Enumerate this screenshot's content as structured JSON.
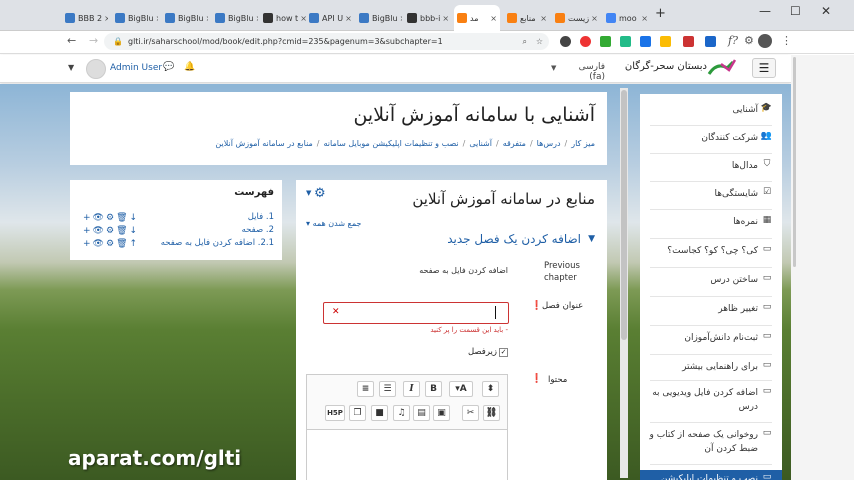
{
  "browser": {
    "tabs": [
      {
        "label": "BBB 2",
        "fav": "#3b79c4"
      },
      {
        "label": "BigBlu",
        "fav": "#3b79c4"
      },
      {
        "label": "BigBlu",
        "fav": "#3b79c4"
      },
      {
        "label": "BigBlu",
        "fav": "#3b79c4"
      },
      {
        "label": "how t",
        "fav": "#333333"
      },
      {
        "label": "API U",
        "fav": "#3b79c4"
      },
      {
        "label": "BigBlu",
        "fav": "#3b79c4"
      },
      {
        "label": "bbb-i",
        "fav": "#333333"
      },
      {
        "label": "مد",
        "fav": "#f98012",
        "active": true
      },
      {
        "label": "منابع",
        "fav": "#f98012"
      },
      {
        "label": "زیست",
        "fav": "#f98012"
      },
      {
        "label": "moo",
        "fav": "#4285f4"
      }
    ],
    "new_tab": "+",
    "url": "glti.ir/saharschool/mod/book/edit.php?cmid=235&pagenum=3&subchapter=1"
  },
  "navbar": {
    "site_name": "دبستان سحر-گرگان",
    "language": "فارسی (fa)",
    "user": "Admin User"
  },
  "header": {
    "title": "آشنایی با سامانه آموزش آنلاین",
    "breadcrumbs": [
      "میز کار",
      "درس‌ها",
      "متفرقه",
      "آشنایی",
      "نصب و تنظیمات اپلیکیشن موبایل سامانه",
      "منابع در سامانه آموزش آنلاین"
    ]
  },
  "sidebar": {
    "items": [
      {
        "label": "آشنایی",
        "icon": "graduation-cap-icon",
        "glyph": "🎓"
      },
      {
        "label": "شرکت کنندگان",
        "icon": "users-icon",
        "glyph": "👥"
      },
      {
        "label": "مدال‌ها",
        "icon": "shield-icon",
        "glyph": "⛉"
      },
      {
        "label": "شایستگی‌ها",
        "icon": "checkbox-icon",
        "glyph": "☑"
      },
      {
        "label": "نمره‌ها",
        "icon": "grades-table-icon",
        "glyph": "▦"
      },
      {
        "label": "کی؟ چی؟ کو؟ کجاست؟",
        "icon": "folder-icon",
        "glyph": "▭"
      },
      {
        "label": "ساختن درس",
        "icon": "folder-icon",
        "glyph": "▭"
      },
      {
        "label": "تغییر ظاهر",
        "icon": "folder-icon",
        "glyph": "▭"
      },
      {
        "label": "ثبت‌نام دانش‌آموزان",
        "icon": "folder-icon",
        "glyph": "▭"
      },
      {
        "label": "برای راهنمایی بیشتر",
        "icon": "folder-icon",
        "glyph": "▭"
      },
      {
        "label": "اضافه کردن فایل ویدیویی به درس",
        "icon": "folder-icon",
        "glyph": "▭"
      },
      {
        "label": "روخوانی یک صفحه از کتاب و ضبط کردن آن",
        "icon": "folder-icon",
        "glyph": "▭"
      },
      {
        "label": "نصب و تنظیمات اپلیکیشن",
        "icon": "folder-icon",
        "glyph": "▭"
      }
    ]
  },
  "main": {
    "title": "منابع در سامانه آموزش آنلاین",
    "collapse_all": "جمع شدن همه",
    "section_title": "اضافه کردن یک فصل جدید",
    "prev_chapter_label": "Previous chapter",
    "prev_chapter_value": "اضافه کردن فایل به صفحه",
    "chapter_title_label": "عنوان فصل",
    "chapter_title_value": "",
    "required_msg": "- باید این قسمت را پر کنید",
    "subchapter_label": "زیرفصل",
    "content_label": "محتوا"
  },
  "toc": {
    "title": "فهرست",
    "items": [
      {
        "label": "1. فایل"
      },
      {
        "label": "2. صفحه"
      },
      {
        "label": "2.1. اضافه کردن فایل به صفحه"
      }
    ]
  },
  "watermark": "aparat.com/glti"
}
